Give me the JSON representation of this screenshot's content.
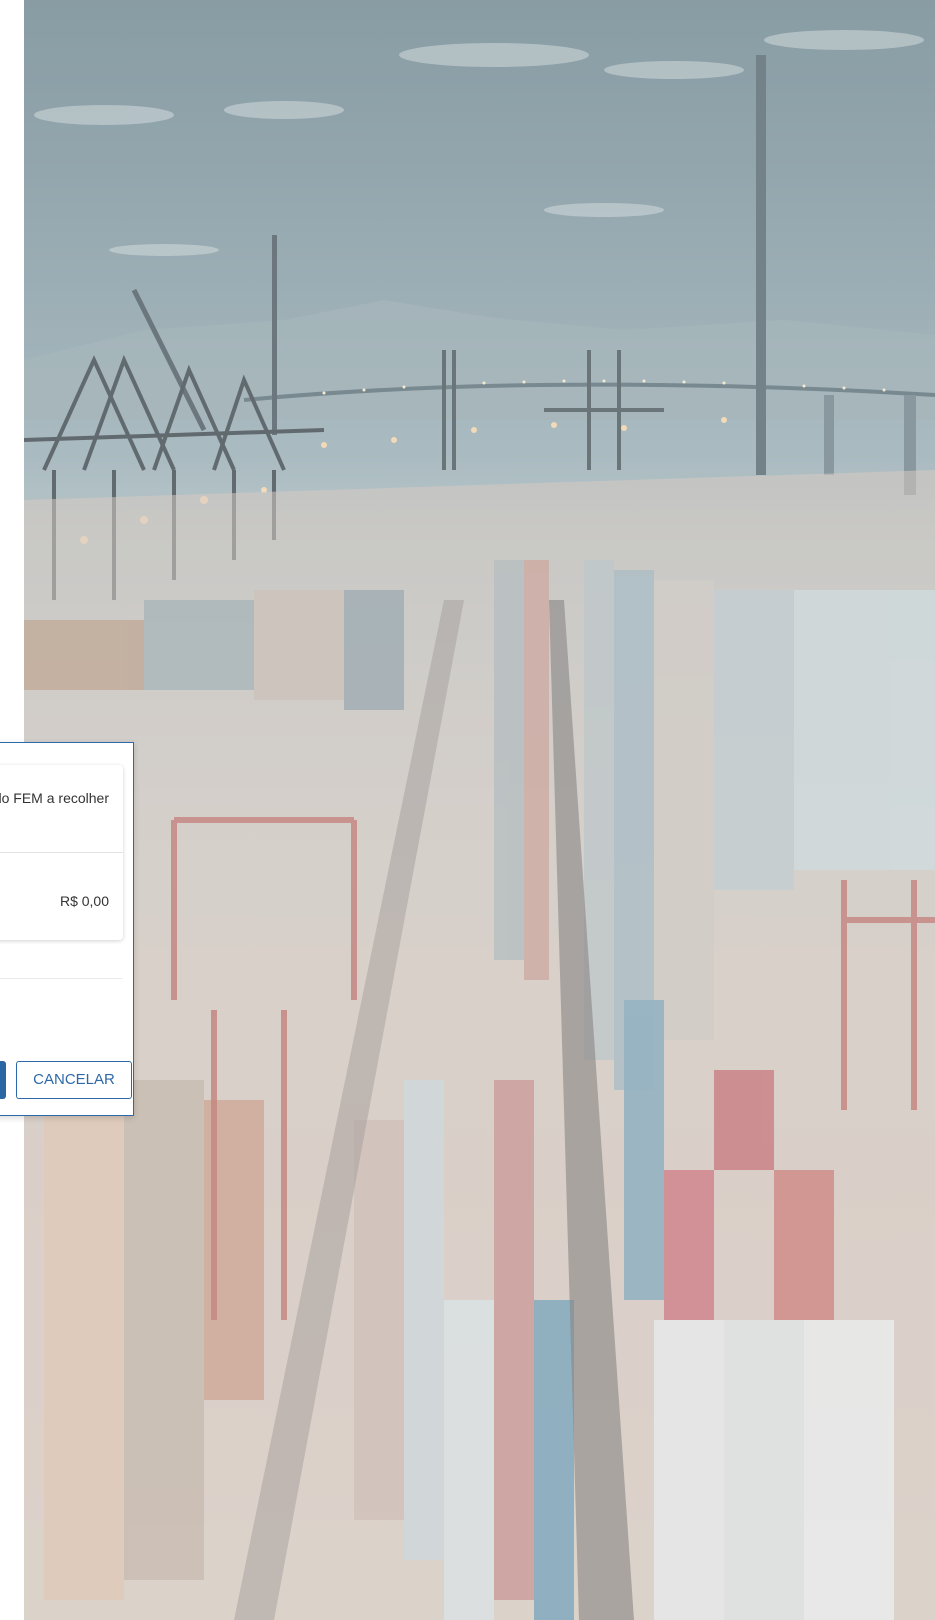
{
  "modal": {
    "fem_label": "tional do FEM a recolher",
    "fem_value": "R$ 0,00",
    "cancel_label": "CANCELAR"
  }
}
